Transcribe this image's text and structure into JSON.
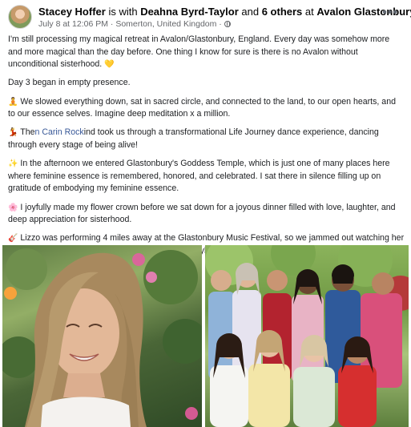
{
  "post": {
    "author": "Stacey Hoffer",
    "with_text": "is with",
    "tagged_person": "Deahna Byrd-Taylor",
    "and_text": "and",
    "others": "6 others",
    "at_text": "at",
    "location": "Avalon Glastonbury.",
    "timestamp": "July 8 at 12:06 PM",
    "separator": " · ",
    "place": "Somerton, United Kingdom",
    "place_separator": " · "
  },
  "paragraphs": {
    "p1": "I'm still processing my magical retreat in Avalon/Glastonbury, England. Every day was somehow more and more magical than the day before. One thing I know for sure is there is no Avalon without unconditional sisterhood.",
    "p2": "Day 3 began in empty presence.",
    "p3": "We slowed everything down, sat in sacred circle, and connected to the land, to our open hearts, and to our essence selves. Imagine deep meditation x a million.",
    "p4_start": "The",
    "p4_mention": "n Carin Rock",
    "p4_end": "ind took us through a transformational Life Journey dance experience, dancing through every stage of being alive!",
    "p5": "In the afternoon we entered Glastonbury's Goddess Temple, which is just one of many places here where feminine essence is remembered, honored, and celebrated. I sat there in silence filling up on gratitude of embodying my feminine essence.",
    "p6": "I joyfully made my flower crown before we sat down for a joyous dinner filled with love, laughter, and deep appreciation for sisterhood.",
    "p7": "Lizzo was performing 4 miles away at the Glastonbury Music Festival, so we jammed out watching her on the BBC before falling asleep in this magical fairyland."
  },
  "emojis": {
    "heart": "💛",
    "meditate": "🧘",
    "dancer": "💃",
    "sparkles": "✨",
    "blossom": "🌸",
    "guitar": "🎸",
    "end": "✨🎀✨"
  },
  "icons": {
    "more": "•••"
  },
  "colors": {
    "link": "#385898",
    "meta": "#65676b"
  }
}
